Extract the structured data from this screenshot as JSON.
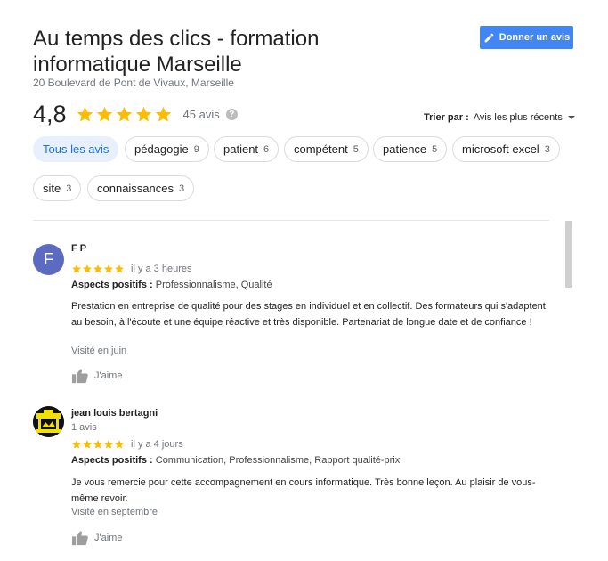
{
  "business": {
    "name": "Au temps des clics - formation informatique Marseille",
    "address": "20 Boulevard de Pont de Vivaux, Marseille"
  },
  "write_review_button": {
    "label": "Donner un avis",
    "icon": "pencil-icon"
  },
  "summary": {
    "rating": "4,8",
    "stars": 5,
    "review_count": "45 avis",
    "help_icon": "question-icon"
  },
  "sort": {
    "label": "Trier par :",
    "value": "Avis les plus récents"
  },
  "filters": [
    {
      "label": "Tous les avis",
      "count": ""
    },
    {
      "label": "pédagogie",
      "count": "9"
    },
    {
      "label": "patient",
      "count": "6"
    },
    {
      "label": "compétent",
      "count": "5"
    },
    {
      "label": "patience",
      "count": "5"
    },
    {
      "label": "microsoft excel",
      "count": "3"
    },
    {
      "label": "site",
      "count": "3"
    },
    {
      "label": "connaissances",
      "count": "3"
    }
  ],
  "reviews": [
    {
      "avatar_letter": "F",
      "name": "F P",
      "stars": 5,
      "time": "il y a 3 heures",
      "aspects_label": "Aspects positifs :",
      "aspects": "Professionnalisme, Qualité",
      "text": "Prestation en entreprise de qualité pour des stages en individuel et en collectif. Des formateurs qui s'adaptent au besoin, à l'écoute et une équipe réactive et très disponible. Partenariat de longue date et de confiance !",
      "visited": "Visité en juin",
      "like_label": "J'aime"
    },
    {
      "avatar_letter": "",
      "name": "jean louis bertagni",
      "sub": "1 avis",
      "stars": 5,
      "time": "il y a 4 jours",
      "aspects_label": "Aspects positifs :",
      "aspects": "Communication, Professionnalisme, Rapport qualité-prix",
      "text": "Je vous remercie pour cette accompagnement en cours informatique. Très bonne leçon. Au plaisir de vous-même revoir.",
      "visited": "Visité en septembre",
      "like_label": "J'aime"
    }
  ],
  "colors": {
    "star": "#fbbc04",
    "accent_button": "#4285f4",
    "active_chip_bg": "#e8f0fe",
    "active_chip_text": "#1a73e8",
    "avatar_f": "#5c6bc0"
  }
}
